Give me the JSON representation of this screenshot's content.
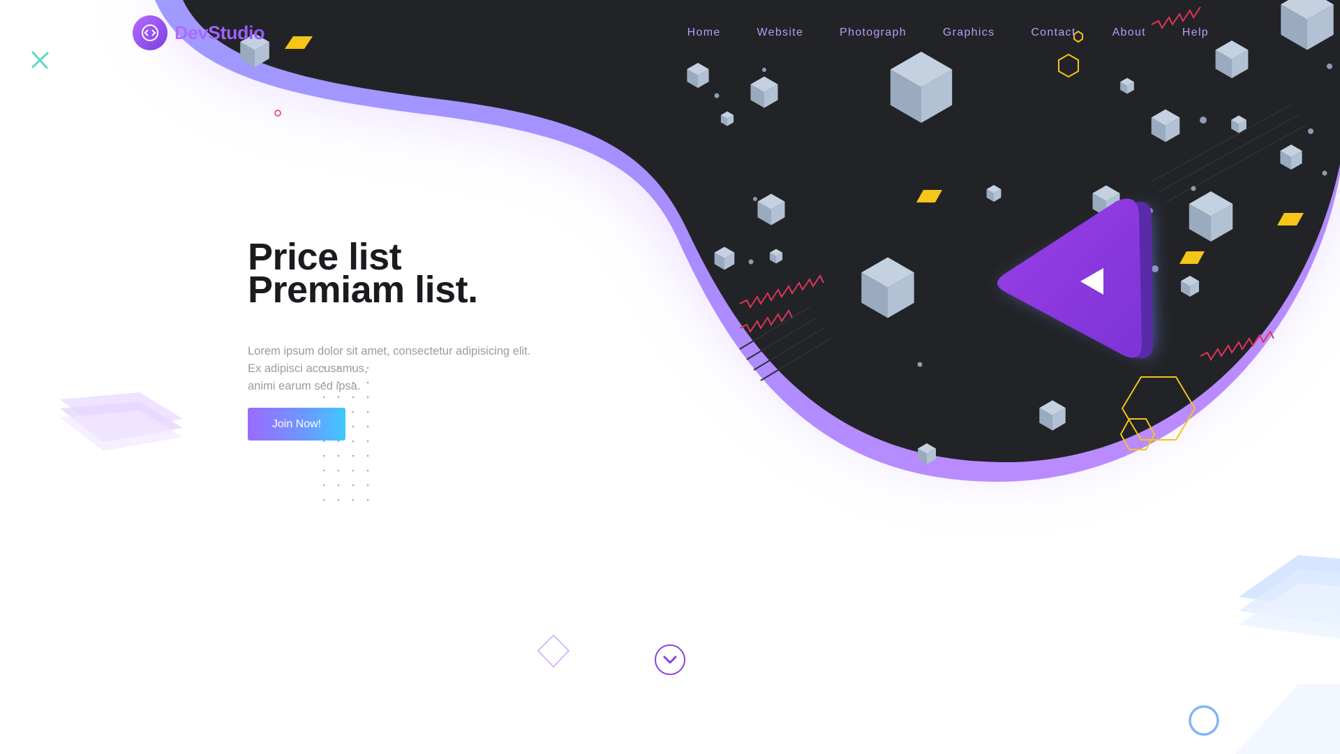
{
  "brand": {
    "name": "DevStudio"
  },
  "nav": {
    "items": [
      "Home",
      "Website",
      "Photograph",
      "Graphics",
      "Contact",
      "About",
      "Help"
    ]
  },
  "hero": {
    "title_line1": "Price list",
    "title_line2": "Premiam list.",
    "desc_line1": "Lorem ipsum dolor sit amet, consectetur adipisicing elit.",
    "desc_line2": "Ex adipisci accusamus,",
    "desc_line3": "animi earum sed ipsa.",
    "cta_label": "Join Now!"
  },
  "icons": {
    "logo": "code-emblem-icon",
    "play": "play-triangle-icon",
    "scroll": "chevron-down-icon"
  },
  "colors": {
    "accent_purple": "#8a3fe0",
    "dark_panel": "#222326",
    "cube": "#a8b8cc",
    "yellow": "#f5c518",
    "pink": "#e0345c"
  }
}
